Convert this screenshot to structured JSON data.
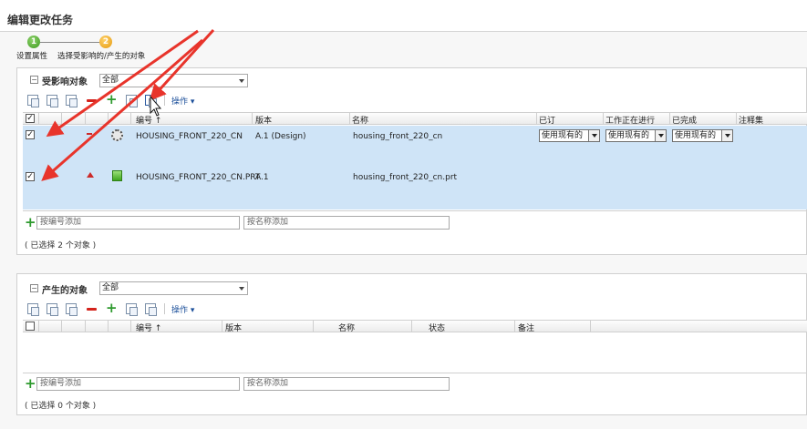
{
  "window": {
    "title": "编辑更改任务"
  },
  "wizard": {
    "steps": [
      {
        "number": "1",
        "label": "设置属性"
      },
      {
        "number": "2",
        "label": "选择受影响的/产生的对象"
      }
    ]
  },
  "affected": {
    "heading": "受影响对象",
    "filter_value": "全部",
    "actions_label": "操作",
    "columns": [
      "编号",
      "版本",
      "名称",
      "已订",
      "工作正在进行",
      "已完成",
      "注释集"
    ],
    "sort_indicator": "↑",
    "rows": [
      {
        "checked": true,
        "number": "HOUSING_FRONT_220_CN",
        "version": "A.1 (Design)",
        "name": "housing_front_220_cn",
        "ordered": "使用现有的",
        "wip": "使用现有的",
        "done": "使用现有的"
      },
      {
        "checked": true,
        "number": "HOUSING_FRONT_220_CN.PRT",
        "version": "A.1",
        "name": "housing_front_220_cn.prt"
      }
    ],
    "add_by_number_placeholder": "按编号添加",
    "add_by_name_placeholder": "按名称添加",
    "selected_count": "( 已选择 2 个对象 )"
  },
  "resulting": {
    "heading": "产生的对象",
    "filter_value": "全部",
    "actions_label": "操作",
    "columns": [
      "编号",
      "版本",
      "名称",
      "状态",
      "备注"
    ],
    "sort_indicator": "↑",
    "add_by_number_placeholder": "按编号添加",
    "add_by_name_placeholder": "按名称添加",
    "selected_count": "( 已选择 0 个对象 )"
  },
  "colors": {
    "selected_row": "#cfe4f7",
    "annotation_arrow": "#e8342b",
    "step1": "#3c9a1e",
    "step2": "#e59a10"
  }
}
